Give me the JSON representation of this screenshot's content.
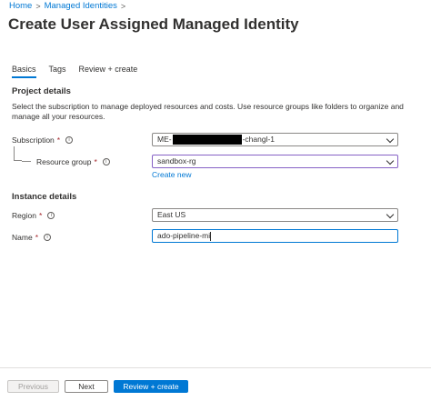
{
  "breadcrumb": {
    "home": "Home",
    "managed_identities": "Managed Identities"
  },
  "page": {
    "title": "Create User Assigned Managed Identity",
    "more": "···"
  },
  "tabs": [
    {
      "label": "Basics",
      "active": true
    },
    {
      "label": "Tags",
      "active": false
    },
    {
      "label": "Review + create",
      "active": false
    }
  ],
  "project_details": {
    "title": "Project details",
    "description": "Select the subscription to manage deployed resources and costs. Use resource groups like folders to organize and manage all your resources.",
    "subscription_label": "Subscription",
    "subscription_prefix": "ME-",
    "subscription_suffix": "-changl-1",
    "resource_group_label": "Resource group",
    "resource_group_value": "sandbox-rg",
    "create_new": "Create new"
  },
  "instance_details": {
    "title": "Instance details",
    "region_label": "Region",
    "region_value": "East US",
    "name_label": "Name",
    "name_value": "ado-pipeline-mi"
  },
  "footer": {
    "previous": "Previous",
    "next": "Next",
    "review_create": "Review + create"
  },
  "required_marker": "*",
  "icons": {
    "info": "info-icon",
    "chevron": "chevron-down-icon"
  },
  "colors": {
    "accent": "#0078d4",
    "required": "#a4262c",
    "focus": "#8661c5"
  }
}
